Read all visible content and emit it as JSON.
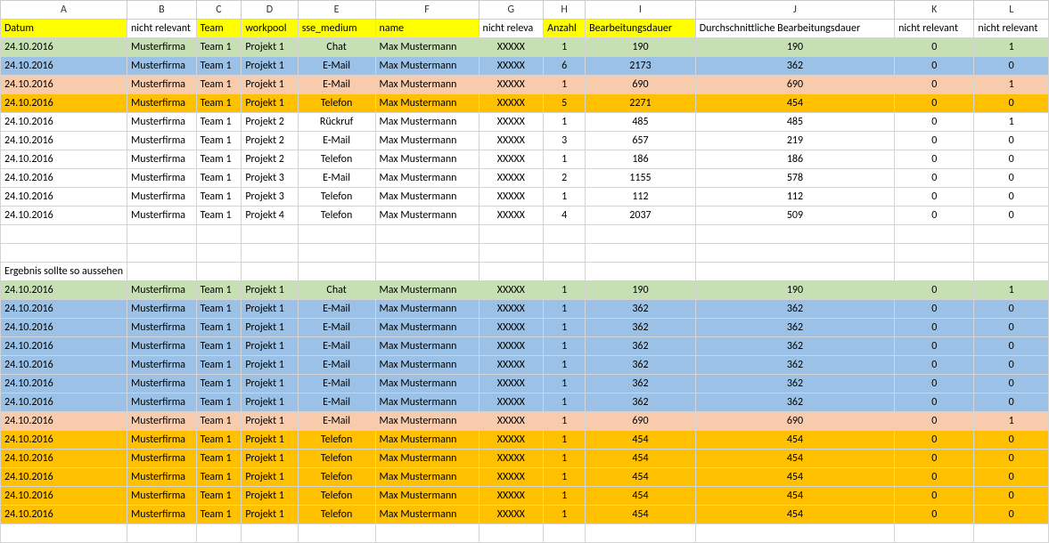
{
  "colLetters": [
    "A",
    "B",
    "C",
    "D",
    "E",
    "F",
    "G",
    "H",
    "I",
    "J",
    "K",
    "L"
  ],
  "headers": {
    "A": "Datum",
    "B": "nicht relevant",
    "C": "Team",
    "D": "workpool",
    "E": "sse_medium",
    "F": "name",
    "G": "nicht releva",
    "H": "Anzahl",
    "I": "Bearbeitungsdauer",
    "J": "Durchschnittliche Bearbeitungsdauer",
    "K": "nicht relevant",
    "L": "nicht relevant"
  },
  "highlightHeaders": [
    "A",
    "C",
    "D",
    "E",
    "F",
    "H",
    "I"
  ],
  "sectionLabel": "Ergebnis sollte so aussehen",
  "table1": [
    {
      "color": "green",
      "A": "24.10.2016",
      "B": "Musterfirma",
      "C": "Team 1",
      "D": "Projekt 1",
      "E": "Chat",
      "F": "Max Mustermann",
      "G": "XXXXX",
      "H": "1",
      "I": "190",
      "J": "190",
      "K": "0",
      "L": "1"
    },
    {
      "color": "blue",
      "A": "24.10.2016",
      "B": "Musterfirma",
      "C": "Team 1",
      "D": "Projekt 1",
      "E": "E-Mail",
      "F": "Max Mustermann",
      "G": "XXXXX",
      "H": "6",
      "I": "2173",
      "J": "362",
      "K": "0",
      "L": "0"
    },
    {
      "color": "peach",
      "A": "24.10.2016",
      "B": "Musterfirma",
      "C": "Team 1",
      "D": "Projekt 1",
      "E": "E-Mail",
      "F": "Max Mustermann",
      "G": "XXXXX",
      "H": "1",
      "I": "690",
      "J": "690",
      "K": "0",
      "L": "1"
    },
    {
      "color": "orange",
      "A": "24.10.2016",
      "B": "Musterfirma",
      "C": "Team 1",
      "D": "Projekt 1",
      "E": "Telefon",
      "F": "Max Mustermann",
      "G": "XXXXX",
      "H": "5",
      "I": "2271",
      "J": "454",
      "K": "0",
      "L": "0"
    },
    {
      "color": "",
      "A": "24.10.2016",
      "B": "Musterfirma",
      "C": "Team 1",
      "D": "Projekt 2",
      "E": "Rückruf",
      "F": "Max Mustermann",
      "G": "XXXXX",
      "H": "1",
      "I": "485",
      "J": "485",
      "K": "0",
      "L": "1"
    },
    {
      "color": "",
      "A": "24.10.2016",
      "B": "Musterfirma",
      "C": "Team 1",
      "D": "Projekt 2",
      "E": "E-Mail",
      "F": "Max Mustermann",
      "G": "XXXXX",
      "H": "3",
      "I": "657",
      "J": "219",
      "K": "0",
      "L": "0"
    },
    {
      "color": "",
      "A": "24.10.2016",
      "B": "Musterfirma",
      "C": "Team 1",
      "D": "Projekt 2",
      "E": "Telefon",
      "F": "Max Mustermann",
      "G": "XXXXX",
      "H": "1",
      "I": "186",
      "J": "186",
      "K": "0",
      "L": "0"
    },
    {
      "color": "",
      "A": "24.10.2016",
      "B": "Musterfirma",
      "C": "Team 1",
      "D": "Projekt 3",
      "E": "E-Mail",
      "F": "Max Mustermann",
      "G": "XXXXX",
      "H": "2",
      "I": "1155",
      "J": "578",
      "K": "0",
      "L": "0"
    },
    {
      "color": "",
      "A": "24.10.2016",
      "B": "Musterfirma",
      "C": "Team 1",
      "D": "Projekt 3",
      "E": "Telefon",
      "F": "Max Mustermann",
      "G": "XXXXX",
      "H": "1",
      "I": "112",
      "J": "112",
      "K": "0",
      "L": "0"
    },
    {
      "color": "",
      "A": "24.10.2016",
      "B": "Musterfirma",
      "C": "Team 1",
      "D": "Projekt 4",
      "E": "Telefon",
      "F": "Max Mustermann",
      "G": "XXXXX",
      "H": "4",
      "I": "2037",
      "J": "509",
      "K": "0",
      "L": "0"
    }
  ],
  "table2": [
    {
      "color": "green",
      "A": "24.10.2016",
      "B": "Musterfirma",
      "C": "Team 1",
      "D": "Projekt 1",
      "E": "Chat",
      "F": "Max Mustermann",
      "G": "XXXXX",
      "H": "1",
      "I": "190",
      "J": "190",
      "K": "0",
      "L": "1"
    },
    {
      "color": "blue",
      "A": "24.10.2016",
      "B": "Musterfirma",
      "C": "Team 1",
      "D": "Projekt 1",
      "E": "E-Mail",
      "F": "Max Mustermann",
      "G": "XXXXX",
      "H": "1",
      "I": "362",
      "J": "362",
      "K": "0",
      "L": "0"
    },
    {
      "color": "blue",
      "A": "24.10.2016",
      "B": "Musterfirma",
      "C": "Team 1",
      "D": "Projekt 1",
      "E": "E-Mail",
      "F": "Max Mustermann",
      "G": "XXXXX",
      "H": "1",
      "I": "362",
      "J": "362",
      "K": "0",
      "L": "0"
    },
    {
      "color": "blue",
      "A": "24.10.2016",
      "B": "Musterfirma",
      "C": "Team 1",
      "D": "Projekt 1",
      "E": "E-Mail",
      "F": "Max Mustermann",
      "G": "XXXXX",
      "H": "1",
      "I": "362",
      "J": "362",
      "K": "0",
      "L": "0"
    },
    {
      "color": "blue",
      "A": "24.10.2016",
      "B": "Musterfirma",
      "C": "Team 1",
      "D": "Projekt 1",
      "E": "E-Mail",
      "F": "Max Mustermann",
      "G": "XXXXX",
      "H": "1",
      "I": "362",
      "J": "362",
      "K": "0",
      "L": "0"
    },
    {
      "color": "blue",
      "A": "24.10.2016",
      "B": "Musterfirma",
      "C": "Team 1",
      "D": "Projekt 1",
      "E": "E-Mail",
      "F": "Max Mustermann",
      "G": "XXXXX",
      "H": "1",
      "I": "362",
      "J": "362",
      "K": "0",
      "L": "0"
    },
    {
      "color": "blue",
      "A": "24.10.2016",
      "B": "Musterfirma",
      "C": "Team 1",
      "D": "Projekt 1",
      "E": "E-Mail",
      "F": "Max Mustermann",
      "G": "XXXXX",
      "H": "1",
      "I": "362",
      "J": "362",
      "K": "0",
      "L": "0"
    },
    {
      "color": "peach",
      "A": "24.10.2016",
      "B": "Musterfirma",
      "C": "Team 1",
      "D": "Projekt 1",
      "E": "E-Mail",
      "F": "Max Mustermann",
      "G": "XXXXX",
      "H": "1",
      "I": "690",
      "J": "690",
      "K": "0",
      "L": "1"
    },
    {
      "color": "orange",
      "A": "24.10.2016",
      "B": "Musterfirma",
      "C": "Team 1",
      "D": "Projekt 1",
      "E": "Telefon",
      "F": "Max Mustermann",
      "G": "XXXXX",
      "H": "1",
      "I": "454",
      "J": "454",
      "K": "0",
      "L": "0"
    },
    {
      "color": "orange",
      "A": "24.10.2016",
      "B": "Musterfirma",
      "C": "Team 1",
      "D": "Projekt 1",
      "E": "Telefon",
      "F": "Max Mustermann",
      "G": "XXXXX",
      "H": "1",
      "I": "454",
      "J": "454",
      "K": "0",
      "L": "0"
    },
    {
      "color": "orange",
      "A": "24.10.2016",
      "B": "Musterfirma",
      "C": "Team 1",
      "D": "Projekt 1",
      "E": "Telefon",
      "F": "Max Mustermann",
      "G": "XXXXX",
      "H": "1",
      "I": "454",
      "J": "454",
      "K": "0",
      "L": "0"
    },
    {
      "color": "orange",
      "A": "24.10.2016",
      "B": "Musterfirma",
      "C": "Team 1",
      "D": "Projekt 1",
      "E": "Telefon",
      "F": "Max Mustermann",
      "G": "XXXXX",
      "H": "1",
      "I": "454",
      "J": "454",
      "K": "0",
      "L": "0"
    },
    {
      "color": "orange",
      "A": "24.10.2016",
      "B": "Musterfirma",
      "C": "Team 1",
      "D": "Projekt 1",
      "E": "Telefon",
      "F": "Max Mustermann",
      "G": "XXXXX",
      "H": "1",
      "I": "454",
      "J": "454",
      "K": "0",
      "L": "0"
    }
  ],
  "colAlign": {
    "A": "left",
    "B": "left",
    "C": "left",
    "D": "left",
    "E": "center",
    "F": "left",
    "G": "center",
    "H": "center",
    "I": "center",
    "J": "center",
    "K": "center",
    "L": "center"
  }
}
